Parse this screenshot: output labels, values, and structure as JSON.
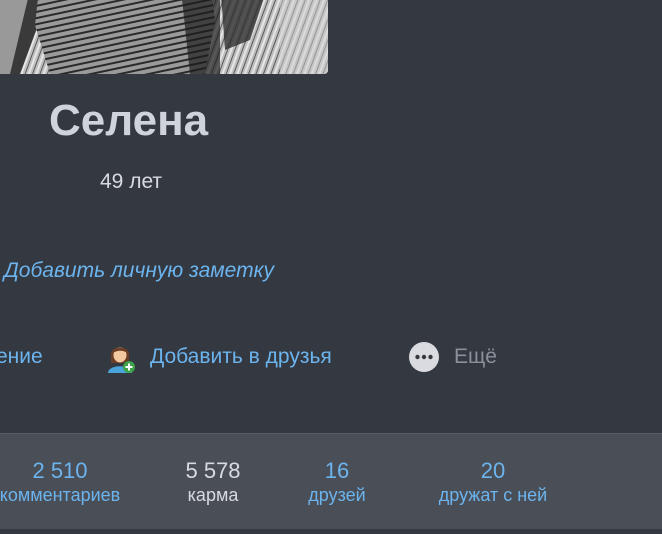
{
  "profile": {
    "name": "Селена",
    "age": "49 лет",
    "note_link": "Добавить личную заметку"
  },
  "actions": {
    "message_partial": "ение",
    "add_friend": "Добавить в друзья",
    "more": "Ещё"
  },
  "stats": [
    {
      "value": "2 510",
      "label": "комментариев"
    },
    {
      "value": "5 578",
      "label": "карма"
    },
    {
      "value": "16",
      "label": "друзей"
    },
    {
      "value": "20",
      "label": "дружат с ней"
    }
  ],
  "colors": {
    "background": "#343841",
    "stats_bar": "#4a4e57",
    "link": "#6cb4ee",
    "name": "#cfd3da",
    "muted": "#8c9099"
  },
  "icons": {
    "add_friend": "add-friend-icon",
    "more": "more-dots-icon"
  }
}
